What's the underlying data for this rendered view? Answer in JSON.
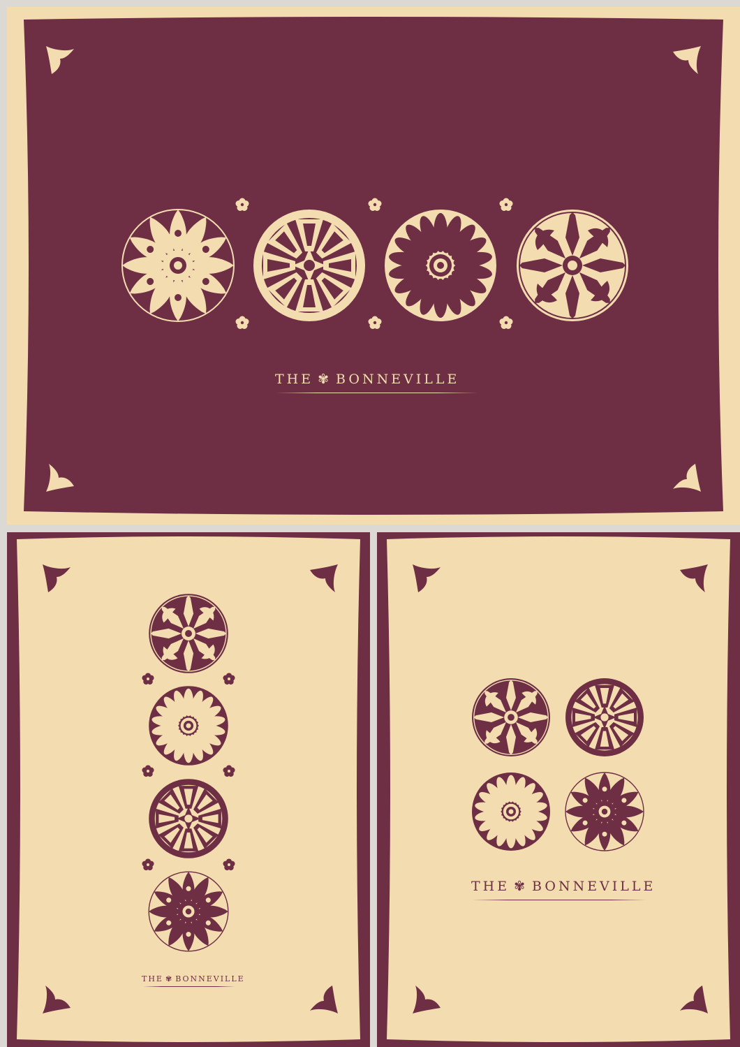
{
  "brand": {
    "word_the": "THE",
    "word_name": "BONNEVILLE"
  },
  "palette": {
    "wine": "#6e2f45",
    "cream": "#f3ddb0",
    "backdrop": "#dcd8d4"
  },
  "cards": [
    {
      "id": "landscape",
      "style": "wine-on-cream",
      "medallions": [
        "lily",
        "gothic",
        "daisy",
        "cross"
      ]
    },
    {
      "id": "portrait-column",
      "style": "cream-on-wine",
      "medallions": [
        "cross",
        "daisy",
        "gothic",
        "lily"
      ]
    },
    {
      "id": "portrait-grid",
      "style": "cream-on-wine",
      "medallions": [
        "cross",
        "gothic",
        "daisy",
        "lily"
      ]
    }
  ]
}
